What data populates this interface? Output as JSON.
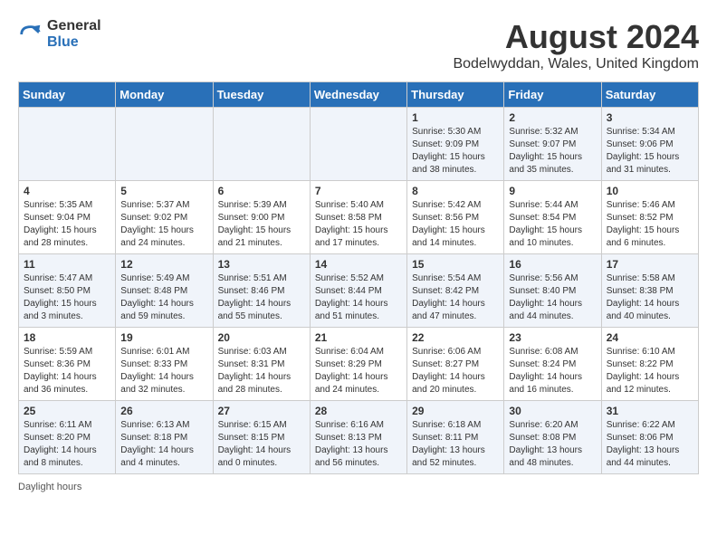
{
  "header": {
    "logo_general": "General",
    "logo_blue": "Blue",
    "month_year": "August 2024",
    "location": "Bodelwyddan, Wales, United Kingdom"
  },
  "days_of_week": [
    "Sunday",
    "Monday",
    "Tuesday",
    "Wednesday",
    "Thursday",
    "Friday",
    "Saturday"
  ],
  "weeks": [
    [
      {
        "day": "",
        "info": ""
      },
      {
        "day": "",
        "info": ""
      },
      {
        "day": "",
        "info": ""
      },
      {
        "day": "",
        "info": ""
      },
      {
        "day": "1",
        "info": "Sunrise: 5:30 AM\nSunset: 9:09 PM\nDaylight: 15 hours\nand 38 minutes."
      },
      {
        "day": "2",
        "info": "Sunrise: 5:32 AM\nSunset: 9:07 PM\nDaylight: 15 hours\nand 35 minutes."
      },
      {
        "day": "3",
        "info": "Sunrise: 5:34 AM\nSunset: 9:06 PM\nDaylight: 15 hours\nand 31 minutes."
      }
    ],
    [
      {
        "day": "4",
        "info": "Sunrise: 5:35 AM\nSunset: 9:04 PM\nDaylight: 15 hours\nand 28 minutes."
      },
      {
        "day": "5",
        "info": "Sunrise: 5:37 AM\nSunset: 9:02 PM\nDaylight: 15 hours\nand 24 minutes."
      },
      {
        "day": "6",
        "info": "Sunrise: 5:39 AM\nSunset: 9:00 PM\nDaylight: 15 hours\nand 21 minutes."
      },
      {
        "day": "7",
        "info": "Sunrise: 5:40 AM\nSunset: 8:58 PM\nDaylight: 15 hours\nand 17 minutes."
      },
      {
        "day": "8",
        "info": "Sunrise: 5:42 AM\nSunset: 8:56 PM\nDaylight: 15 hours\nand 14 minutes."
      },
      {
        "day": "9",
        "info": "Sunrise: 5:44 AM\nSunset: 8:54 PM\nDaylight: 15 hours\nand 10 minutes."
      },
      {
        "day": "10",
        "info": "Sunrise: 5:46 AM\nSunset: 8:52 PM\nDaylight: 15 hours\nand 6 minutes."
      }
    ],
    [
      {
        "day": "11",
        "info": "Sunrise: 5:47 AM\nSunset: 8:50 PM\nDaylight: 15 hours\nand 3 minutes."
      },
      {
        "day": "12",
        "info": "Sunrise: 5:49 AM\nSunset: 8:48 PM\nDaylight: 14 hours\nand 59 minutes."
      },
      {
        "day": "13",
        "info": "Sunrise: 5:51 AM\nSunset: 8:46 PM\nDaylight: 14 hours\nand 55 minutes."
      },
      {
        "day": "14",
        "info": "Sunrise: 5:52 AM\nSunset: 8:44 PM\nDaylight: 14 hours\nand 51 minutes."
      },
      {
        "day": "15",
        "info": "Sunrise: 5:54 AM\nSunset: 8:42 PM\nDaylight: 14 hours\nand 47 minutes."
      },
      {
        "day": "16",
        "info": "Sunrise: 5:56 AM\nSunset: 8:40 PM\nDaylight: 14 hours\nand 44 minutes."
      },
      {
        "day": "17",
        "info": "Sunrise: 5:58 AM\nSunset: 8:38 PM\nDaylight: 14 hours\nand 40 minutes."
      }
    ],
    [
      {
        "day": "18",
        "info": "Sunrise: 5:59 AM\nSunset: 8:36 PM\nDaylight: 14 hours\nand 36 minutes."
      },
      {
        "day": "19",
        "info": "Sunrise: 6:01 AM\nSunset: 8:33 PM\nDaylight: 14 hours\nand 32 minutes."
      },
      {
        "day": "20",
        "info": "Sunrise: 6:03 AM\nSunset: 8:31 PM\nDaylight: 14 hours\nand 28 minutes."
      },
      {
        "day": "21",
        "info": "Sunrise: 6:04 AM\nSunset: 8:29 PM\nDaylight: 14 hours\nand 24 minutes."
      },
      {
        "day": "22",
        "info": "Sunrise: 6:06 AM\nSunset: 8:27 PM\nDaylight: 14 hours\nand 20 minutes."
      },
      {
        "day": "23",
        "info": "Sunrise: 6:08 AM\nSunset: 8:24 PM\nDaylight: 14 hours\nand 16 minutes."
      },
      {
        "day": "24",
        "info": "Sunrise: 6:10 AM\nSunset: 8:22 PM\nDaylight: 14 hours\nand 12 minutes."
      }
    ],
    [
      {
        "day": "25",
        "info": "Sunrise: 6:11 AM\nSunset: 8:20 PM\nDaylight: 14 hours\nand 8 minutes."
      },
      {
        "day": "26",
        "info": "Sunrise: 6:13 AM\nSunset: 8:18 PM\nDaylight: 14 hours\nand 4 minutes."
      },
      {
        "day": "27",
        "info": "Sunrise: 6:15 AM\nSunset: 8:15 PM\nDaylight: 14 hours\nand 0 minutes."
      },
      {
        "day": "28",
        "info": "Sunrise: 6:16 AM\nSunset: 8:13 PM\nDaylight: 13 hours\nand 56 minutes."
      },
      {
        "day": "29",
        "info": "Sunrise: 6:18 AM\nSunset: 8:11 PM\nDaylight: 13 hours\nand 52 minutes."
      },
      {
        "day": "30",
        "info": "Sunrise: 6:20 AM\nSunset: 8:08 PM\nDaylight: 13 hours\nand 48 minutes."
      },
      {
        "day": "31",
        "info": "Sunrise: 6:22 AM\nSunset: 8:06 PM\nDaylight: 13 hours\nand 44 minutes."
      }
    ]
  ],
  "footer": {
    "note": "Daylight hours"
  }
}
